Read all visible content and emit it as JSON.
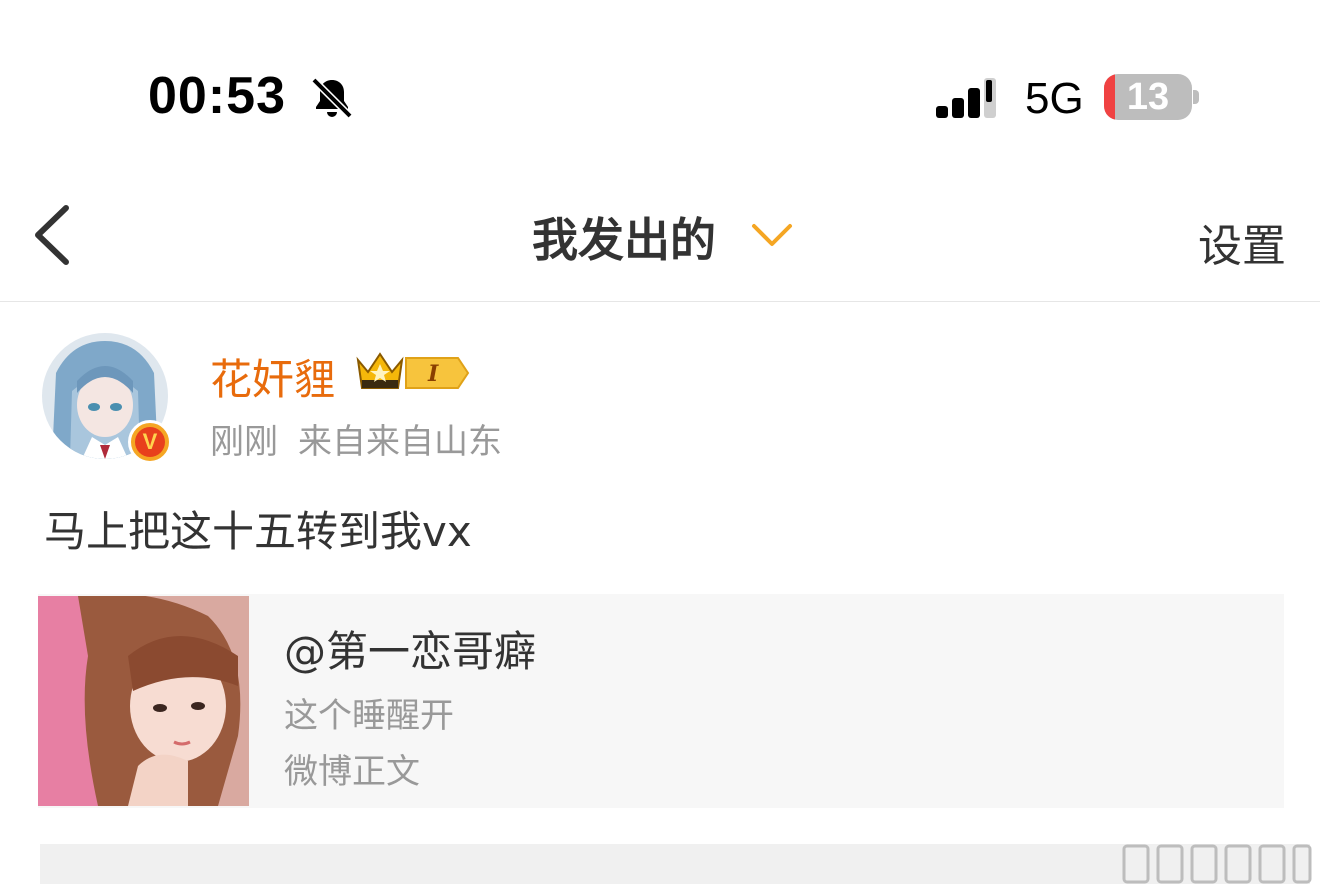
{
  "status_bar": {
    "time": "00:53",
    "network": "5G",
    "battery_level": "13",
    "battery_percent": 13,
    "icons": [
      "bell-slash-icon",
      "signal-bars-icon",
      "battery-icon"
    ]
  },
  "nav": {
    "back_icon": "chevron-left-icon",
    "title": "我发出的",
    "title_dropdown_icon": "chevron-down-icon",
    "settings_label": "设置",
    "accent_color": "#f5a623"
  },
  "post": {
    "author": {
      "name": "花奸貍",
      "name_color": "#e86b0c",
      "verified_badge": "V",
      "level_badge": "I"
    },
    "time": "刚刚",
    "location": "来自来自山东",
    "text": "马上把这十五转到我vx",
    "repost": {
      "author": "@第一恋哥癖",
      "excerpt": "这个睡醒开",
      "source": "微博正文"
    }
  }
}
